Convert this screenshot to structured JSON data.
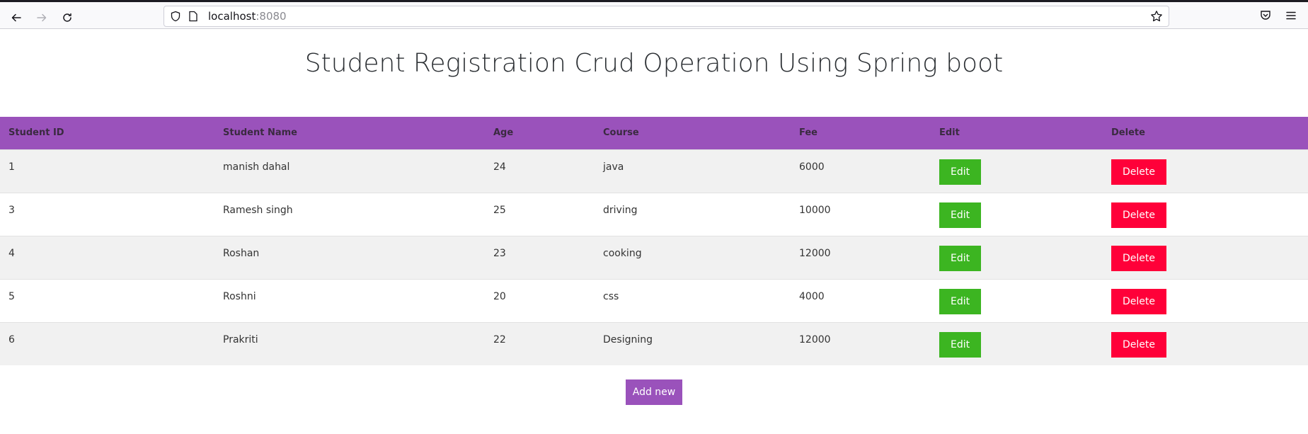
{
  "browser": {
    "url_host": "localhost",
    "url_port": ":8080"
  },
  "page": {
    "title": "Student Registration Crud Operation Using Spring boot"
  },
  "table": {
    "headers": [
      "Student ID",
      "Student Name",
      "Age",
      "Course",
      "Fee",
      "Edit",
      "Delete"
    ],
    "rows": [
      {
        "id": "1",
        "name": "manish dahal",
        "age": "24",
        "course": "java",
        "fee": "6000"
      },
      {
        "id": "3",
        "name": "Ramesh singh",
        "age": "25",
        "course": "driving",
        "fee": "10000"
      },
      {
        "id": "4",
        "name": "Roshan",
        "age": "23",
        "course": "cooking",
        "fee": "12000"
      },
      {
        "id": "5",
        "name": "Roshni",
        "age": "20",
        "course": "css",
        "fee": "4000"
      },
      {
        "id": "6",
        "name": "Prakriti",
        "age": "22",
        "course": "Designing",
        "fee": "12000"
      }
    ],
    "edit_label": "Edit",
    "delete_label": "Delete"
  },
  "actions": {
    "add_new_label": "Add new"
  },
  "colors": {
    "header_bg": "#9a52bb",
    "edit_bg": "#3cb521",
    "delete_bg": "#ff0039"
  }
}
